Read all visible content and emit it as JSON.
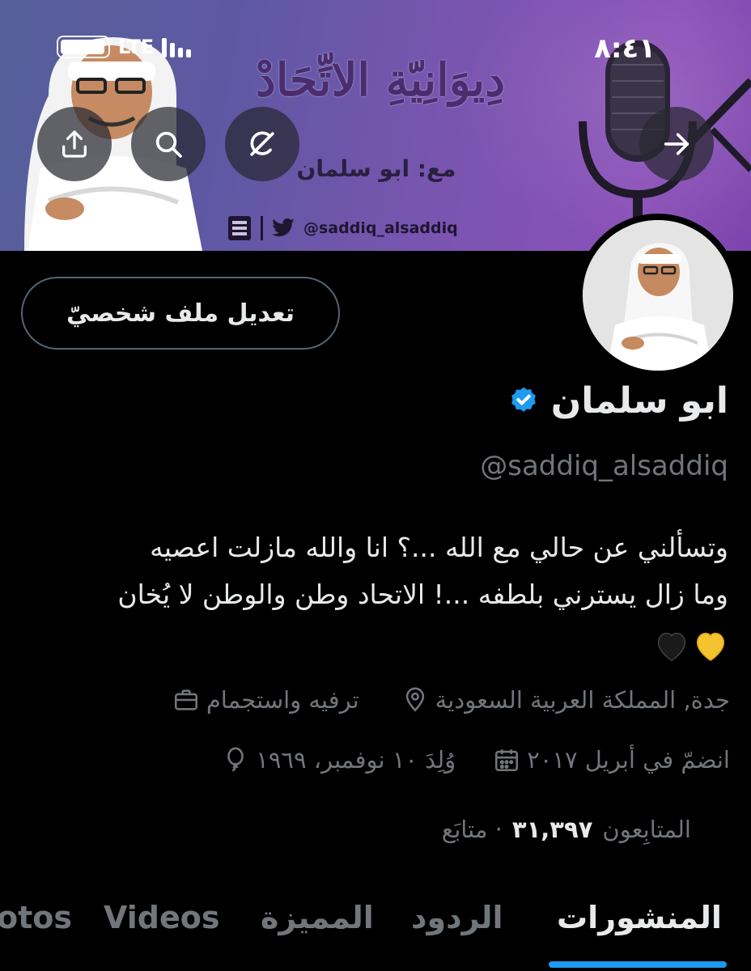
{
  "status_bar": {
    "carrier": "LTE",
    "time": "٨:٤١"
  },
  "banner": {
    "title": "دِيوَانِيّةِ الاتِّحَادْ",
    "subtitle": "مع: ابو سلمان",
    "handle": "@saddiq_alsaddiq"
  },
  "profile": {
    "edit_button": "تعديل ملف شخصيّ",
    "display_name": "ابو سلمان",
    "handle": "@saddiq_alsaddiq",
    "bio_line1": "وتسألني عن حالي مع الله ...؟ انا والله مازلت اعصيه",
    "bio_line2": "وما زال يسترني بلطفه ...! الاتحاد وطن والوطن لا يُخان",
    "category": "ترفيه واستجمام",
    "location": "جدة, المملكة العربية السعودية",
    "birthday": "وُلِدَ ١٠ نوفمبر، ١٩٦٩",
    "joined": "انضمّ في أبريل ٢٠١٧",
    "following_label": "متابَع",
    "followers_count": "٣١,٣٩٧",
    "followers_label": "المتابِعون"
  },
  "tabs": [
    "المنشورات",
    "الردود",
    "المميزة",
    "Videos",
    "otos"
  ],
  "colors": {
    "accent": "#1d9bf0",
    "muted": "#71767b",
    "heart_gold": "#f4c430",
    "heart_black": "#1a1a1a"
  }
}
